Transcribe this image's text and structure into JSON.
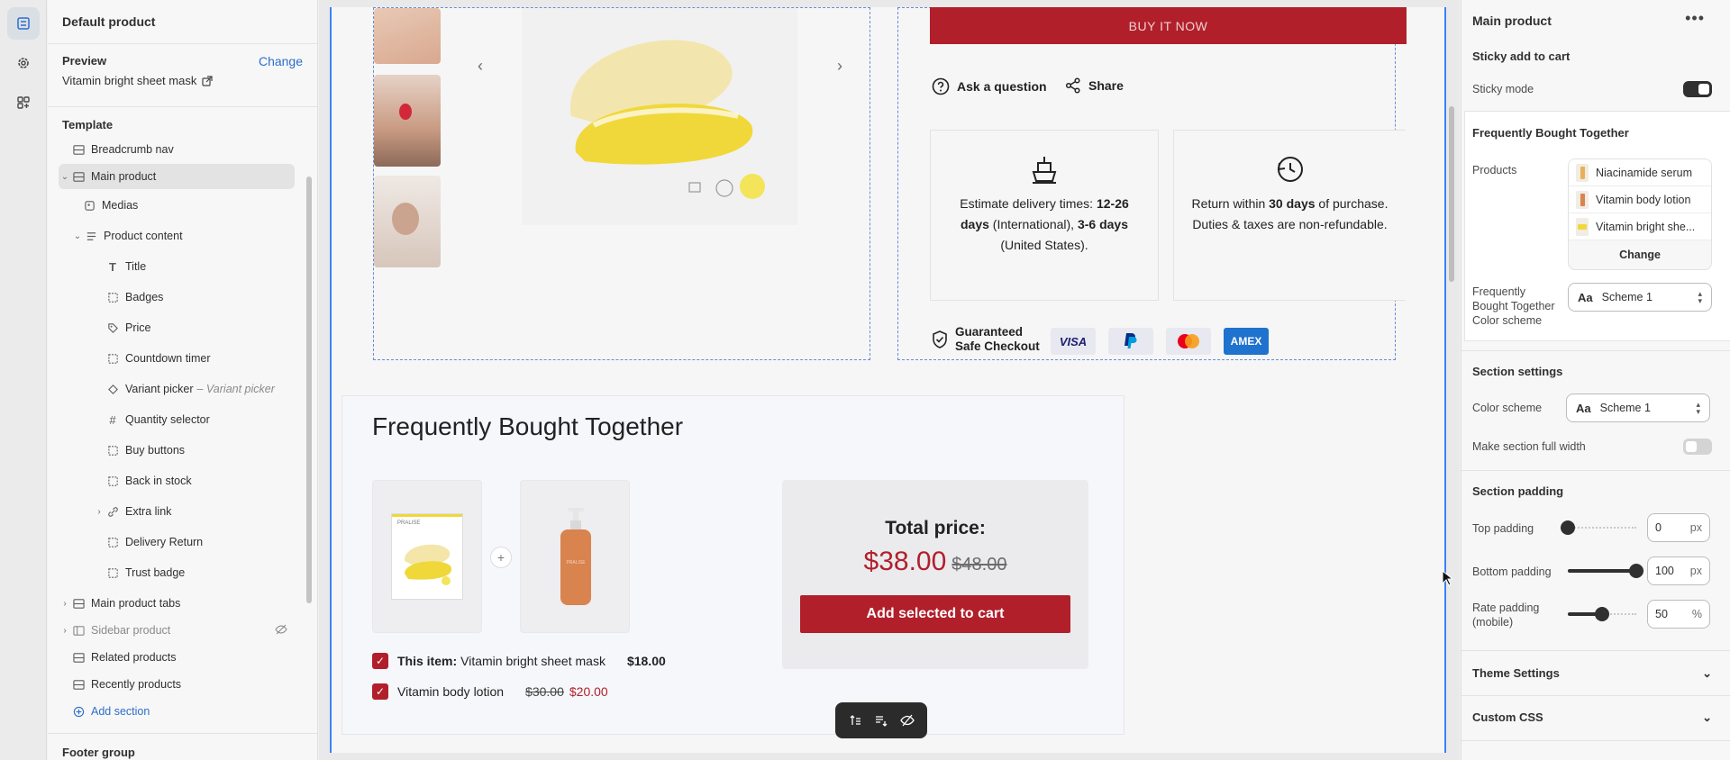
{
  "rail": {
    "icons": [
      "sections-icon",
      "settings-gear-icon",
      "apps-icon"
    ]
  },
  "sidebar": {
    "title": "Default product",
    "preview_label": "Preview",
    "preview_change": "Change",
    "preview_value": "Vitamin bright sheet mask",
    "template_label": "Template",
    "items": [
      {
        "label": "Breadcrumb nav"
      },
      {
        "label": "Main product"
      },
      {
        "label": "Medias"
      },
      {
        "label": "Product content"
      },
      {
        "label": "Title"
      },
      {
        "label": "Badges"
      },
      {
        "label": "Price"
      },
      {
        "label": "Countdown timer"
      },
      {
        "label": "Variant picker",
        "suffix": "– Variant picker"
      },
      {
        "label": "Quantity selector"
      },
      {
        "label": "Buy buttons"
      },
      {
        "label": "Back in stock"
      },
      {
        "label": "Extra link"
      },
      {
        "label": "Delivery Return"
      },
      {
        "label": "Trust badge"
      },
      {
        "label": "Main product tabs"
      },
      {
        "label": "Sidebar product"
      },
      {
        "label": "Related products"
      },
      {
        "label": "Recently products"
      }
    ],
    "add_section": "Add section",
    "footer_group": "Footer group"
  },
  "canvas": {
    "buy_now": "BUY IT NOW",
    "ask_question": "Ask a question",
    "share": "Share",
    "delivery_text_pre": "Estimate delivery times: ",
    "delivery_bold1": "12-26 days",
    "delivery_mid": " (International), ",
    "delivery_bold2": "3-6 days",
    "delivery_post": " (United States).",
    "return_pre": "Return within ",
    "return_bold": "30 days",
    "return_post": " of purchase. Duties & taxes are non-refundable.",
    "safe_checkout": "Guaranteed Safe Checkout",
    "cards": [
      "VISA",
      "PayPal",
      "Mastercard",
      "AMEX"
    ],
    "fbt": {
      "title": "Frequently Bought Together",
      "item1_prefix": "This item:",
      "item1_name": "Vitamin bright sheet mask",
      "item1_price": "$18.00",
      "item2_name": "Vitamin body lotion",
      "item2_old": "$30.00",
      "item2_new": "$20.00",
      "total_label": "Total price:",
      "total_now": "$38.00",
      "total_old": "$48.00",
      "add_button": "Add selected to cart",
      "pack_brand": "PRALISE",
      "bottle_brand": "PRALISE"
    }
  },
  "rpanel": {
    "title": "Main product",
    "sticky_heading": "Sticky add to cart",
    "sticky_mode": "Sticky mode",
    "fbt_heading": "Frequently Bought Together",
    "products_label": "Products",
    "products": [
      "Niacinamide serum",
      "Vitamin body lotion",
      "Vitamin bright she..."
    ],
    "products_change": "Change",
    "fbt_color_label": "Frequently Bought Together Color scheme",
    "fbt_scheme": "Scheme 1",
    "section_settings": "Section settings",
    "color_scheme_label": "Color scheme",
    "color_scheme": "Scheme 1",
    "full_width_label": "Make section full width",
    "section_padding": "Section padding",
    "top_padding_label": "Top padding",
    "top_padding": "0",
    "top_padding_level": 0,
    "bottom_padding_label": "Bottom padding",
    "bottom_padding": "100",
    "bottom_padding_level": 1.0,
    "rate_padding_label": "Rate padding (mobile)",
    "rate_padding": "50",
    "rate_padding_level": 0.5,
    "unit_px": "px",
    "unit_pct": "%",
    "theme_settings": "Theme Settings",
    "custom_css": "Custom CSS"
  },
  "colors": {
    "brand_red": "#b11f2b",
    "accent_blue": "#2c6ecb"
  }
}
